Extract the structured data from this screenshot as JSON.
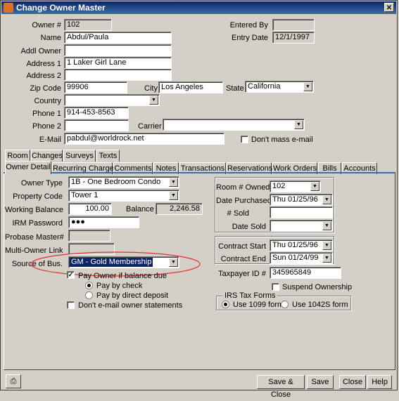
{
  "window": {
    "title": "Change Owner Master"
  },
  "header": {
    "owner_num_label": "Owner #",
    "owner_num": "102",
    "entered_by_label": "Entered By",
    "entered_by": "",
    "name_label": "Name",
    "name": "Abdul/Paula",
    "entry_date_label": "Entry Date",
    "entry_date": "12/1/1997",
    "addl_owner_label": "Addl Owner",
    "addl_owner": "",
    "address1_label": "Address 1",
    "address1": "1 Laker Girl Lane",
    "address2_label": "Address 2",
    "address2": "",
    "zip_label": "Zip Code",
    "zip": "99906",
    "city_label": "City",
    "city": "Los Angeles",
    "state_label": "State",
    "state": "California",
    "country_label": "Country",
    "country": "",
    "phone1_label": "Phone 1",
    "phone1": "914-453-8563",
    "phone2_label": "Phone 2",
    "phone2": "",
    "carrier_label": "Carrier",
    "carrier": "",
    "email_label": "E-Mail",
    "email": "pabdul@worldrock.net",
    "dont_mass_email_label": "Don't mass e-mail",
    "dont_mass_email": false
  },
  "tabs_row1": [
    "Room",
    "Changes",
    "Surveys",
    "Texts"
  ],
  "tabs_row2": [
    "Owner Detail",
    "Recurring Charges",
    "Comments",
    "Notes",
    "Transactions",
    "Reservations",
    "Work Orders",
    "Bills",
    "Accounts"
  ],
  "active_tab": "Owner Detail",
  "detail": {
    "owner_type_label": "Owner Type",
    "owner_type": "1B - One Bedroom Condo",
    "property_code_label": "Property Code",
    "property_code": "Tower 1",
    "working_balance_label": "Working Balance",
    "working_balance": "100.00",
    "balance_label": "Balance",
    "balance": "2,246.58",
    "irm_password_label": "IRM Password",
    "irm_password": "●●●",
    "probase_master_label": "Probase Master#",
    "probase_master": "",
    "multi_owner_link_label": "Multi-Owner Link",
    "multi_owner_link": "",
    "source_of_bus_label": "Source of Bus.",
    "source_of_bus": "GM - Gold Membership",
    "pay_owner_label": "Pay Owner if balance due",
    "pay_owner": true,
    "pay_by_check_label": "Pay by check",
    "pay_by_direct_label": "Pay by direct deposit",
    "dont_email_statements_label": "Don't e-mail owner statements"
  },
  "room": {
    "room_owned_label": "Room # Owned",
    "room_owned": "102",
    "date_purchased_label": "Date Purchased",
    "date_purchased": "Thu 01/25/96",
    "sold_label": "# Sold",
    "sold": "",
    "date_sold_label": "Date Sold",
    "date_sold": ""
  },
  "contract": {
    "start_label": "Contract Start",
    "start": "Thu 01/25/96",
    "end_label": "Contract End",
    "end": "Sun 01/24/99"
  },
  "taxpayer_label": "Taxpayer ID #",
  "taxpayer_id": "345965849",
  "suspend_label": "Suspend Ownership",
  "irs": {
    "title": "IRS Tax Forms",
    "opt1": "Use 1099 form",
    "opt2": "Use 1042S form"
  },
  "buttons": {
    "save_close": "Save & Close",
    "save": "Save",
    "close": "Close",
    "help": "Help"
  },
  "colors": {
    "highlight": "#0a246a",
    "annotation": "#e03030",
    "title_bar": "#0a246a"
  }
}
